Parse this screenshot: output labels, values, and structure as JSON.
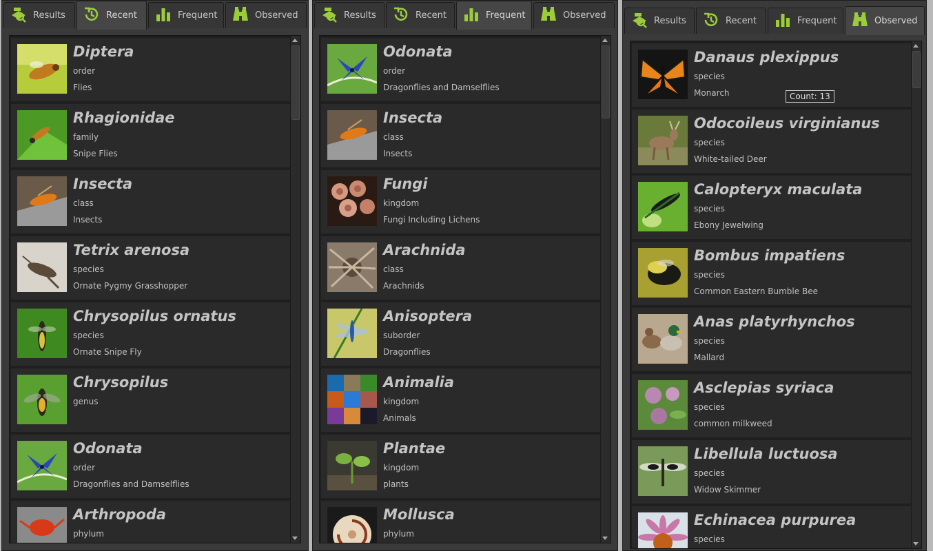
{
  "tabs": {
    "results": "Results",
    "recent": "Recent",
    "frequent": "Frequent",
    "observed": "Observed"
  },
  "colors": {
    "accent": "#9bcc3a",
    "panel": "#3a3a3a",
    "item_bg": "#2a2a2a"
  },
  "icons": {
    "results": "search-map-icon",
    "recent": "history-icon",
    "frequent": "bar-chart-icon",
    "observed": "binoculars-icon"
  },
  "panels": [
    {
      "active_tab": "Recent",
      "items": [
        {
          "name": "Diptera",
          "rank": "order",
          "common": "Flies"
        },
        {
          "name": "Rhagionidae",
          "rank": "family",
          "common": "Snipe Flies"
        },
        {
          "name": "Insecta",
          "rank": "class",
          "common": "Insects"
        },
        {
          "name": "Tetrix arenosa",
          "rank": "species",
          "common": "Ornate Pygmy Grasshopper"
        },
        {
          "name": "Chrysopilus ornatus",
          "rank": "species",
          "common": "Ornate Snipe Fly"
        },
        {
          "name": "Chrysopilus",
          "rank": "genus",
          "common": ""
        },
        {
          "name": "Odonata",
          "rank": "order",
          "common": "Dragonflies and Damselflies"
        },
        {
          "name": "Arthropoda",
          "rank": "phylum",
          "common": ""
        }
      ]
    },
    {
      "active_tab": "Frequent",
      "items": [
        {
          "name": "Odonata",
          "rank": "order",
          "common": "Dragonflies and Damselflies"
        },
        {
          "name": "Insecta",
          "rank": "class",
          "common": "Insects"
        },
        {
          "name": "Fungi",
          "rank": "kingdom",
          "common": "Fungi Including Lichens"
        },
        {
          "name": "Arachnida",
          "rank": "class",
          "common": "Arachnids"
        },
        {
          "name": "Anisoptera",
          "rank": "suborder",
          "common": "Dragonflies"
        },
        {
          "name": "Animalia",
          "rank": "kingdom",
          "common": "Animals"
        },
        {
          "name": "Plantae",
          "rank": "kingdom",
          "common": "plants"
        },
        {
          "name": "Mollusca",
          "rank": "phylum",
          "common": ""
        }
      ]
    },
    {
      "active_tab": "Observed",
      "tooltip": "Count: 13",
      "items": [
        {
          "name": "Danaus plexippus",
          "rank": "species",
          "common": "Monarch"
        },
        {
          "name": "Odocoileus virginianus",
          "rank": "species",
          "common": "White-tailed Deer"
        },
        {
          "name": "Calopteryx maculata",
          "rank": "species",
          "common": "Ebony Jewelwing"
        },
        {
          "name": "Bombus impatiens",
          "rank": "species",
          "common": "Common Eastern Bumble Bee"
        },
        {
          "name": "Anas platyrhynchos",
          "rank": "species",
          "common": "Mallard"
        },
        {
          "name": "Asclepias syriaca",
          "rank": "species",
          "common": "common milkweed"
        },
        {
          "name": "Libellula luctuosa",
          "rank": "species",
          "common": "Widow Skimmer"
        },
        {
          "name": "Echinacea purpurea",
          "rank": "species",
          "common": ""
        }
      ]
    }
  ]
}
